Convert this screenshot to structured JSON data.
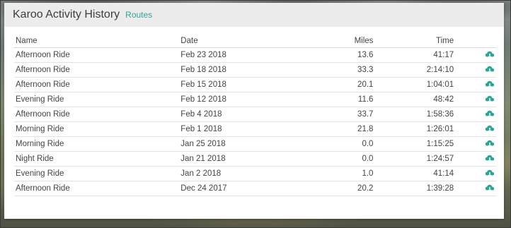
{
  "header": {
    "title": "Karoo Activity History",
    "link": "Routes"
  },
  "table": {
    "columns": [
      "Name",
      "Date",
      "Miles",
      "Time"
    ],
    "rows": [
      {
        "name": "Afternoon Ride",
        "date": "Feb 23 2018",
        "miles": "13.6",
        "time": "41:17"
      },
      {
        "name": "Afternoon Ride",
        "date": "Feb 18 2018",
        "miles": "33.3",
        "time": "2:14:10"
      },
      {
        "name": "Afternoon Ride",
        "date": "Feb 15 2018",
        "miles": "20.1",
        "time": "1:04:01"
      },
      {
        "name": "Evening Ride",
        "date": "Feb 12 2018",
        "miles": "11.6",
        "time": "48:42"
      },
      {
        "name": "Afternoon Ride",
        "date": "Feb 4 2018",
        "miles": "33.7",
        "time": "1:58:36"
      },
      {
        "name": "Morning Ride",
        "date": "Feb 1 2018",
        "miles": "21.8",
        "time": "1:26:01"
      },
      {
        "name": "Morning Ride",
        "date": "Jan 25 2018",
        "miles": "0.0",
        "time": "1:15:25"
      },
      {
        "name": "Night Ride",
        "date": "Jan 21 2018",
        "miles": "0.0",
        "time": "1:24:57"
      },
      {
        "name": "Evening Ride",
        "date": "Jan 2 2018",
        "miles": "1.0",
        "time": "41:14"
      },
      {
        "name": "Afternoon Ride",
        "date": "Dec 24 2017",
        "miles": "20.2",
        "time": "1:39:28"
      }
    ],
    "row_action_icon": "cloud-download-icon"
  },
  "colors": {
    "accent": "#2ca596",
    "header_bg": "#ececec",
    "text": "#444444"
  }
}
